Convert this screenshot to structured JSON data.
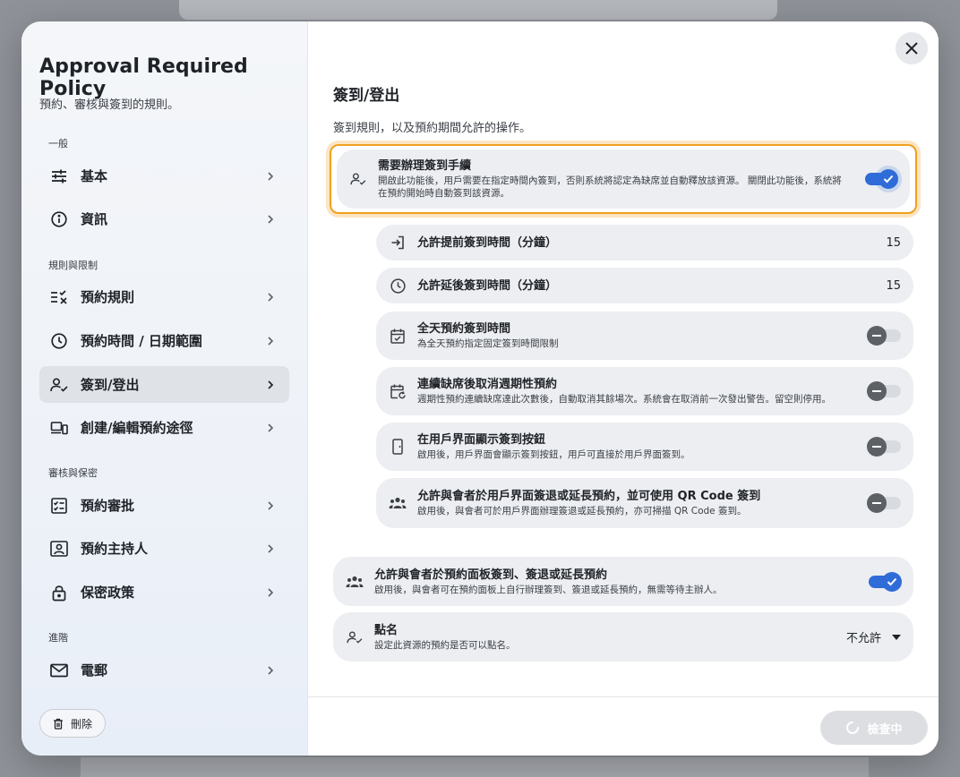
{
  "sidebar": {
    "title": "Approval Required Policy",
    "subtitle": "預約、審核與簽到的規則。",
    "sections": {
      "general": "一般",
      "rules": "規則與限制",
      "review": "審核與保密",
      "advanced": "進階"
    },
    "items": [
      {
        "label": "基本",
        "icon": "sliders-icon"
      },
      {
        "label": "資訊",
        "icon": "info-icon"
      },
      {
        "label": "預約規則",
        "icon": "rules-check-icon"
      },
      {
        "label": "預約時間 / 日期範圍",
        "icon": "clock-icon"
      },
      {
        "label": "簽到/登出",
        "icon": "person-check-icon",
        "active": true
      },
      {
        "label": "創建/編輯預約途徑",
        "icon": "devices-icon"
      },
      {
        "label": "預約審批",
        "icon": "approval-checklist-icon"
      },
      {
        "label": "預約主持人",
        "icon": "host-badge-icon"
      },
      {
        "label": "保密政策",
        "icon": "lock-icon"
      },
      {
        "label": "電郵",
        "icon": "mail-icon"
      }
    ],
    "delete_label": "刪除"
  },
  "main": {
    "title": "簽到/登出",
    "subtitle": "簽到規則，以及預約期間允許的操作。",
    "require_checkin": {
      "title": "需要辦理簽到手續",
      "desc": "開啟此功能後，用戶需要在指定時間內簽到，否則系統將認定為缺席並自動釋放該資源。 關閉此功能後，系統將在預約開始時自動簽到該資源。",
      "enabled": true
    },
    "early_checkin": {
      "title": "允許提前簽到時間（分鐘）",
      "value": "15"
    },
    "late_checkin": {
      "title": "允許延後簽到時間（分鐘）",
      "value": "15"
    },
    "allday_checkin": {
      "title": "全天預約簽到時間",
      "desc": "為全天預約指定固定簽到時間限制",
      "enabled": false
    },
    "cancel_recurring": {
      "title": "連續缺席後取消週期性預約",
      "desc": "週期性預約連續缺席達此次數後，自動取消其餘場次。系統會在取消前一次發出警告。留空則停用。",
      "enabled": false
    },
    "show_checkin_button": {
      "title": "在用戶界面顯示簽到按鈕",
      "desc": "啟用後，用戶界面會顯示簽到按鈕，用戶可直接於用戶界面簽到。",
      "enabled": false
    },
    "attendee_ui_actions": {
      "title": "允許與會者於用戶界面簽退或延長預約，並可使用 QR Code 簽到",
      "desc": "啟用後，與會者可於用戶界面辦理簽退或延長預約，亦可掃描 QR Code 簽到。",
      "enabled": false
    },
    "attendee_panel_actions": {
      "title": "允許與會者於預約面板簽到、簽退或延長預約",
      "desc": "啟用後，與會者可在預約面板上自行辦理簽到、簽退或延長預約，無需等待主辦人。",
      "enabled": true
    },
    "roll_call": {
      "title": "點名",
      "desc": "設定此資源的預約是否可以點名。",
      "value": "不允許"
    }
  },
  "footer": {
    "check_label": "檢查中"
  },
  "colors": {
    "accent": "#2f6cd8",
    "highlight": "#f0a01e"
  }
}
